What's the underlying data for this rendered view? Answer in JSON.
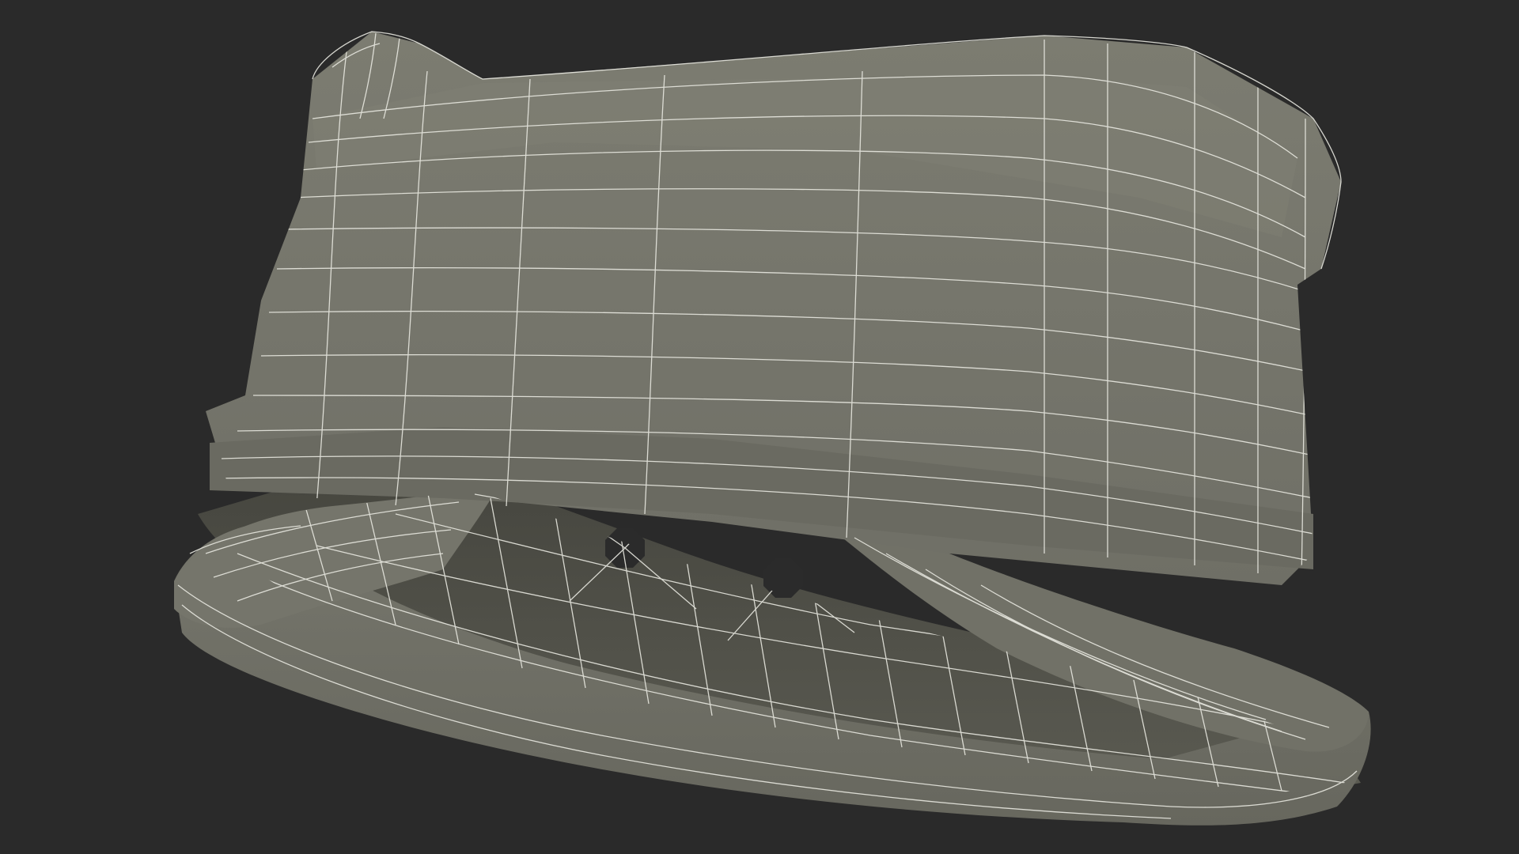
{
  "render": {
    "subject": "wireframe-cap-model",
    "colors": {
      "background": "#2a2a2a",
      "surface_light": "#7a7a6f",
      "surface_mid": "#6e6e64",
      "surface_dark": "#5a5a51",
      "surface_inner": "#54544c",
      "wire": "#e8e8e0",
      "hole": "#2b2b2b"
    }
  }
}
